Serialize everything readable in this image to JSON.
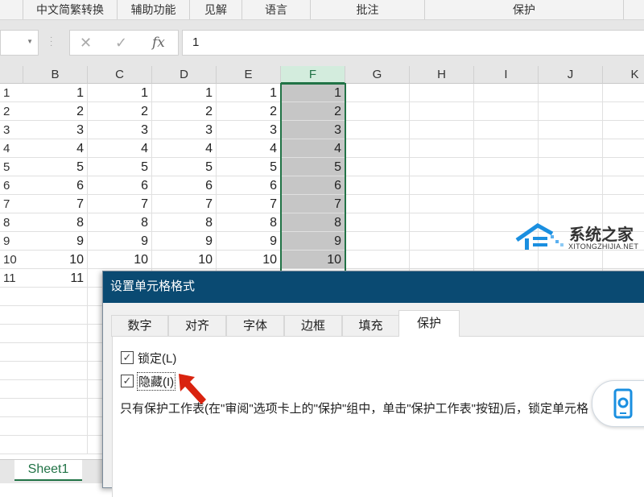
{
  "ribbon": {
    "groups": [
      "中文简繁转换",
      "辅助功能",
      "见解",
      "语言",
      "批注",
      "保护"
    ]
  },
  "formula_bar": {
    "cancel_icon": "✕",
    "enter_icon": "✓",
    "fx_label": "fx",
    "value": "1"
  },
  "grid": {
    "columns": [
      "B",
      "C",
      "D",
      "E",
      "F",
      "G",
      "H",
      "I",
      "J",
      "K"
    ],
    "selected_column": "F",
    "rows": [
      {
        "n": "1",
        "v": [
          "1",
          "1",
          "1",
          "1",
          "1"
        ]
      },
      {
        "n": "2",
        "v": [
          "2",
          "2",
          "2",
          "2",
          "2"
        ]
      },
      {
        "n": "3",
        "v": [
          "3",
          "3",
          "3",
          "3",
          "3"
        ]
      },
      {
        "n": "4",
        "v": [
          "4",
          "4",
          "4",
          "4",
          "4"
        ]
      },
      {
        "n": "5",
        "v": [
          "5",
          "5",
          "5",
          "5",
          "5"
        ]
      },
      {
        "n": "6",
        "v": [
          "6",
          "6",
          "6",
          "6",
          "6"
        ]
      },
      {
        "n": "7",
        "v": [
          "7",
          "7",
          "7",
          "7",
          "7"
        ]
      },
      {
        "n": "8",
        "v": [
          "8",
          "8",
          "8",
          "8",
          "8"
        ]
      },
      {
        "n": "9",
        "v": [
          "9",
          "9",
          "9",
          "9",
          "9"
        ]
      },
      {
        "n": "10",
        "v": [
          "10",
          "10",
          "10",
          "10",
          "10"
        ]
      },
      {
        "n": "11",
        "v": [
          "11",
          "",
          "",
          "",
          ""
        ]
      }
    ]
  },
  "sheet_tab": "Sheet1",
  "dialog": {
    "title": "设置单元格格式",
    "tabs": [
      "数字",
      "对齐",
      "字体",
      "边框",
      "填充",
      "保护"
    ],
    "active_tab": "保护",
    "locked_label": "锁定(L)",
    "locked_checked": true,
    "hidden_label": "隐藏(I)",
    "hidden_checked": true,
    "check_mark": "✓",
    "description": "只有保护工作表(在\"审阅\"选项卡上的\"保护\"组中，单击\"保护工作表\"按钮)后，锁定单元格"
  },
  "watermark": {
    "cn": "系统之家",
    "en": "XITONGZHIJIA.NET"
  },
  "colors": {
    "accent": "#217346",
    "dialog_title": "#0a4a72",
    "arrow": "#d9230f"
  }
}
